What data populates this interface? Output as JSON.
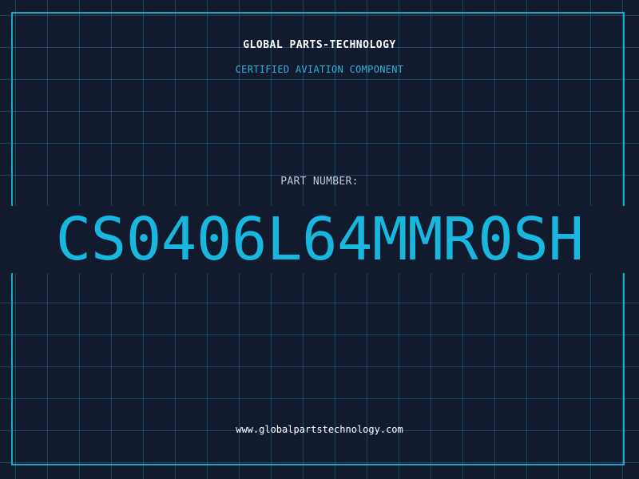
{
  "header": {
    "company": "GLOBAL PARTS-TECHNOLOGY",
    "tagline": "CERTIFIED AVIATION COMPONENT"
  },
  "part": {
    "label": "PART NUMBER:",
    "number": "CS0406L64MMR0SH"
  },
  "footer": {
    "website": "www.globalpartstechnology.com"
  },
  "colors": {
    "background": "#121a2d",
    "grid": "#1e6e8c",
    "accent": "#17b7e0",
    "text": "#ffffff"
  }
}
